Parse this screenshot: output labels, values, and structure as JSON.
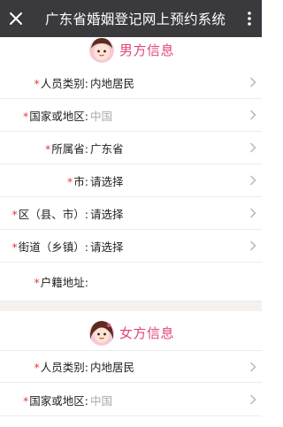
{
  "topbar": {
    "title": "广东省婚姻登记网上预约系统",
    "close_icon": "close-icon",
    "more_icon": "more-vertical-icon"
  },
  "male_section": {
    "title": "男方信息",
    "rows": [
      {
        "label": "人员类别:",
        "value": "内地居民",
        "required": true,
        "muted": false,
        "arrow": true
      },
      {
        "label": "国家或地区:",
        "value": "中国",
        "required": true,
        "muted": true,
        "arrow": true
      },
      {
        "label": "所属省:",
        "value": "广东省",
        "required": true,
        "muted": false,
        "arrow": true
      },
      {
        "label": "市:",
        "value": "请选择",
        "required": true,
        "muted": false,
        "arrow": true
      },
      {
        "label": "区（县、市）:",
        "value": "请选择",
        "required": true,
        "muted": false,
        "arrow": true
      },
      {
        "label": "街道（乡镇）:",
        "value": "请选择",
        "required": true,
        "muted": false,
        "arrow": true
      },
      {
        "label": "户籍地址:",
        "value": "",
        "required": true,
        "muted": false,
        "arrow": false
      }
    ]
  },
  "female_section": {
    "title": "女方信息",
    "rows": [
      {
        "label": "人员类别:",
        "value": "内地居民",
        "required": true,
        "muted": false,
        "arrow": true
      },
      {
        "label": "国家或地区:",
        "value": "中国",
        "required": true,
        "muted": true,
        "arrow": true
      }
    ]
  },
  "colors": {
    "accent": "#e0457a",
    "required": "#e23b3b",
    "topbar": "#3a3a3e"
  }
}
